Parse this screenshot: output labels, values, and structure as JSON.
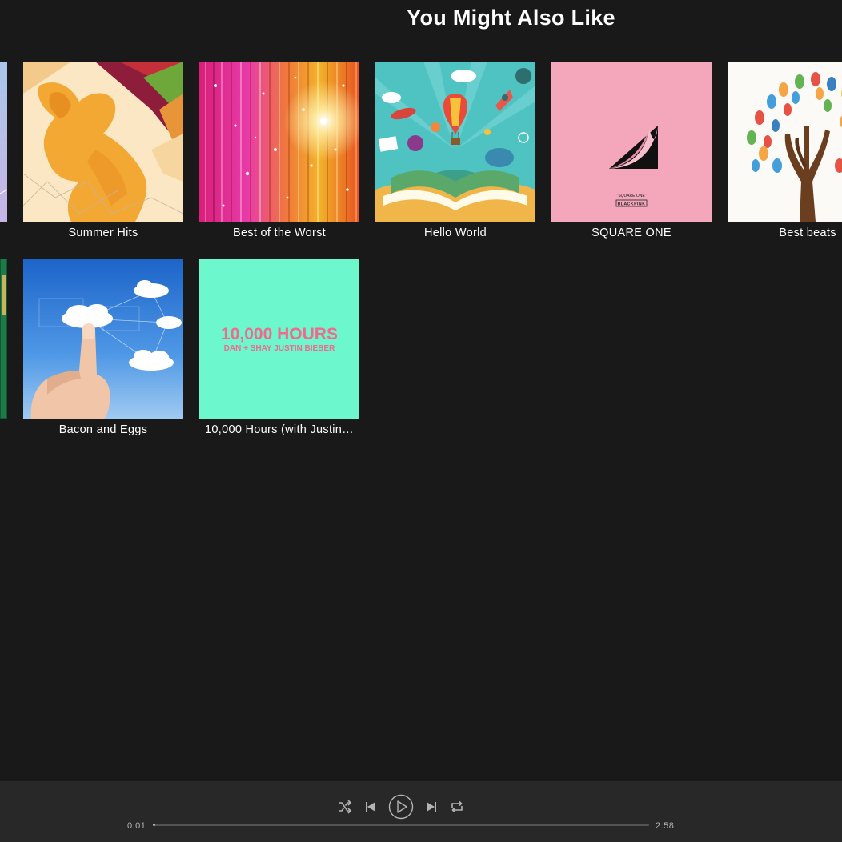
{
  "section": {
    "title": "You Might Also Like"
  },
  "cards": [
    {
      "label": "Summer Hits",
      "art": "silhouette-jumper-art"
    },
    {
      "label": "Best of the Worst",
      "art": "sparkle-stripes-art"
    },
    {
      "label": "Hello World",
      "art": "open-book-balloon-art"
    },
    {
      "label": "SQUARE ONE",
      "art": "pink-page-curl-art"
    },
    {
      "label": "Best beats",
      "art": "hand-tree-art"
    },
    {
      "label": "Bacon and Eggs",
      "art": "hand-touch-cloud-art"
    },
    {
      "label": "10,000 Hours (with Justin…",
      "art": "mint-text-art"
    }
  ],
  "album_art_text": {
    "square_one_small": "\"SQUARE ONE\"",
    "square_one_brand": "BLACKPINK",
    "hours_title": "10,000 HOURS",
    "hours_artists": "DAN + SHAY JUSTIN BIEBER"
  },
  "player": {
    "current_time": "0:01",
    "total_time": "2:58",
    "progress_percent": 0.5,
    "icons": [
      "shuffle-icon",
      "previous-icon",
      "play-icon",
      "next-icon",
      "repeat-icon"
    ]
  },
  "colors": {
    "background": "#191919",
    "player_bar": "#282828",
    "control_icon": "#b3b3b3",
    "square_one_pink": "#f4a7bb",
    "hours_mint": "#6cf7cc",
    "hours_text": "#f06a8f"
  }
}
